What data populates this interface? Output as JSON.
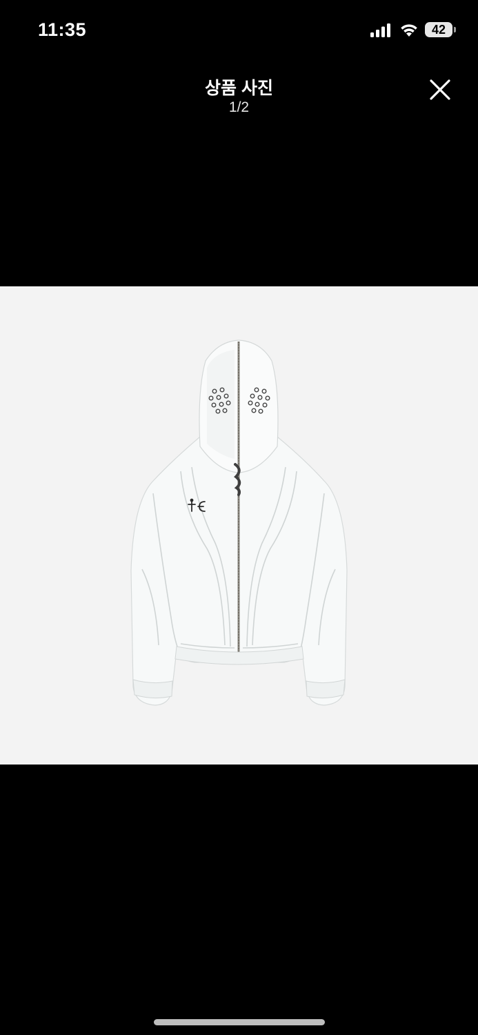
{
  "status_bar": {
    "time": "11:35",
    "battery_level": "42",
    "icons": [
      "cellular-signal-icon",
      "wifi-icon",
      "battery-icon"
    ]
  },
  "header": {
    "title": "상품 사진",
    "counter": "1/2",
    "close_icon": "close-icon"
  },
  "photo": {
    "subject": "product-photo",
    "logo_text": "ϮЄ",
    "background_color": "#f3f3f3",
    "garment_color": "#f7f9f9"
  },
  "colors": {
    "screen_background": "#000000",
    "home_indicator": "#bdbdbd"
  }
}
